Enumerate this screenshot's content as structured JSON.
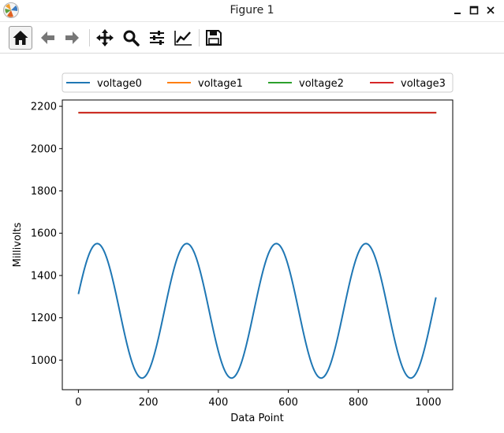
{
  "window": {
    "title": "Figure 1",
    "controls": [
      "minimize",
      "maximize",
      "close"
    ]
  },
  "toolbar": {
    "buttons": [
      {
        "name": "home-icon",
        "tooltip": "Reset original view",
        "active": true
      },
      {
        "name": "back-arrow-icon",
        "tooltip": "Back"
      },
      {
        "name": "forward-arrow-icon",
        "tooltip": "Forward"
      },
      {
        "name": "pan-move-icon",
        "tooltip": "Pan"
      },
      {
        "name": "zoom-magnifier-icon",
        "tooltip": "Zoom"
      },
      {
        "name": "subplots-sliders-icon",
        "tooltip": "Configure subplots"
      },
      {
        "name": "axes-line-chart-icon",
        "tooltip": "Edit axis"
      },
      {
        "name": "save-floppy-icon",
        "tooltip": "Save"
      }
    ]
  },
  "chart_data": {
    "type": "line",
    "title": "",
    "xlabel": "Data Point",
    "ylabel": "Millivolts",
    "xlim": [
      -46,
      1070
    ],
    "ylim": [
      860,
      2230
    ],
    "xticks": [
      0,
      200,
      400,
      600,
      800,
      1000
    ],
    "yticks": [
      1000,
      1200,
      1400,
      1600,
      1800,
      2000,
      2200
    ],
    "grid": false,
    "legend": {
      "placement": "top",
      "columns": 4
    },
    "series": [
      {
        "name": "voltage0",
        "color": "#1f77b4",
        "shape": "sine",
        "x_start": 0,
        "x_end": 1023,
        "mean_mv": 1233,
        "amplitude_mv": 318,
        "period_points": 256,
        "start_value_mv": 1312,
        "first_peak_x": 55
      },
      {
        "name": "voltage1",
        "color": "#ff7f0e",
        "x": [
          0,
          1023
        ],
        "y": [
          2170,
          2170
        ]
      },
      {
        "name": "voltage2",
        "color": "#2ca02c",
        "x": [
          0,
          1023
        ],
        "y": [
          2170,
          2170
        ]
      },
      {
        "name": "voltage3",
        "color": "#d62728",
        "x": [
          0,
          1023
        ],
        "y": [
          2170,
          2170
        ]
      }
    ]
  }
}
